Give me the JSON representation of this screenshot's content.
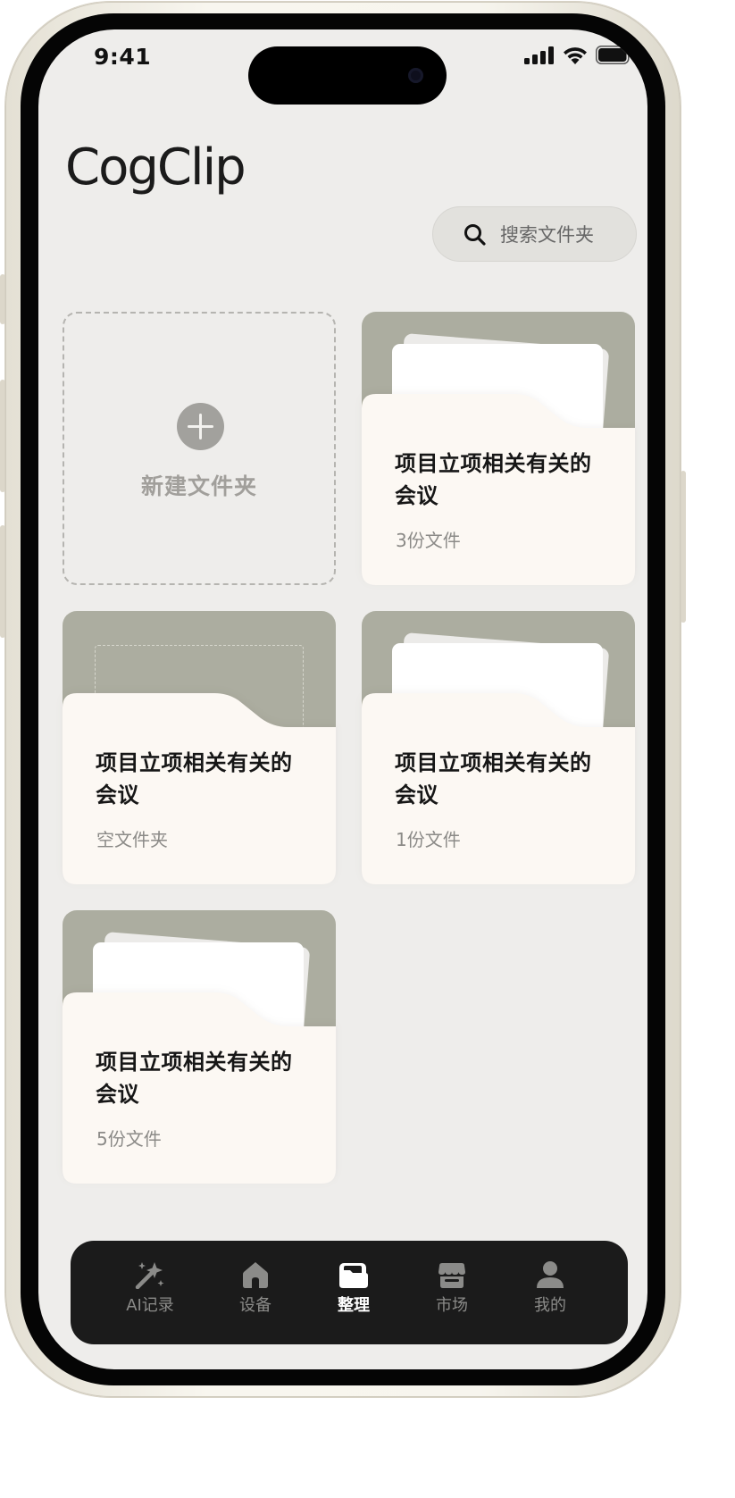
{
  "status_bar": {
    "time": "9:41"
  },
  "header": {
    "logo": "CogClip",
    "search": {
      "placeholder": "搜索文件夹",
      "icon": "search-icon"
    }
  },
  "new_folder": {
    "label": "新建文件夹",
    "icon": "plus-circle-icon"
  },
  "folders": [
    {
      "title": "项目立项相关有关的会议",
      "subtitle": "3份文件",
      "empty": false
    },
    {
      "title": "项目立项相关有关的会议",
      "subtitle": "空文件夹",
      "empty": true
    },
    {
      "title": "项目立项相关有关的会议",
      "subtitle": "1份文件",
      "empty": false
    },
    {
      "title": "项目立项相关有关的会议",
      "subtitle": "5份文件",
      "empty": false
    }
  ],
  "tabbar": {
    "items": [
      {
        "label": "AI记录",
        "icon": "ai-sparkle-icon",
        "active": false
      },
      {
        "label": "设备",
        "icon": "home-icon",
        "active": false
      },
      {
        "label": "整理",
        "icon": "folder-icon",
        "active": true
      },
      {
        "label": "市场",
        "icon": "store-icon",
        "active": false
      },
      {
        "label": "我的",
        "icon": "user-icon",
        "active": false
      }
    ]
  },
  "colors": {
    "screen_bg": "#eeedeb",
    "folder_back": "#acada0",
    "folder_front": "#fcf8f3",
    "tabbar_bg": "#1b1b1b",
    "tab_active": "#ffffff",
    "tab_inactive": "#8b8b89"
  }
}
